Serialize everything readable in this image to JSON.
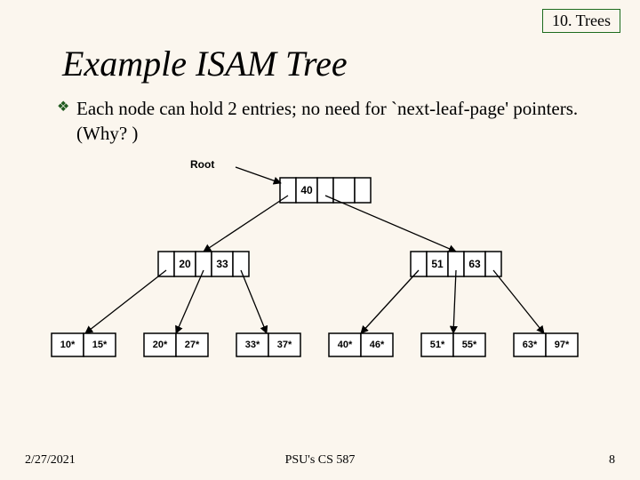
{
  "chapter": "10. Trees",
  "title": "Example ISAM Tree",
  "bullet": "Each node can hold 2 entries; no need for `next-leaf-page' pointers.  (Why? )",
  "root_label": "Root",
  "tree": {
    "root": {
      "cells": [
        "40",
        ""
      ]
    },
    "idx_left": {
      "cells": [
        "20",
        "33"
      ]
    },
    "idx_right": {
      "cells": [
        "51",
        "63"
      ]
    },
    "leaves": [
      {
        "cells": [
          "10*",
          "15*"
        ]
      },
      {
        "cells": [
          "20*",
          "27*"
        ]
      },
      {
        "cells": [
          "33*",
          "37*"
        ]
      },
      {
        "cells": [
          "40*",
          "46*"
        ]
      },
      {
        "cells": [
          "51*",
          "55*"
        ]
      },
      {
        "cells": [
          "63*",
          "97*"
        ]
      }
    ]
  },
  "footer": {
    "date": "2/27/2021",
    "course": "PSU's CS 587",
    "page": "8"
  }
}
